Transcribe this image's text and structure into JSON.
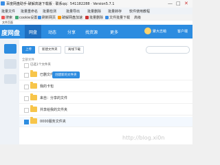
{
  "window": {
    "title": "百度网盘助手-破解高速下载版 · 联系qq：541182288 · Version5.7.1",
    "minimize": "—",
    "maximize": "□",
    "close": "✕"
  },
  "menu": {
    "items": [
      "批量文件",
      "批量重命名",
      "批量检测",
      "批量导出",
      "批量删除",
      "批量转存",
      "软件使用教程"
    ]
  },
  "toolbar": {
    "items": [
      "搜索",
      "cookie设置",
      "刷新网页",
      "破解网盘加速",
      "批量删除",
      "文件批量下载",
      "高级"
    ]
  },
  "address": {
    "text": "文件页面"
  },
  "nav": {
    "logo": "度网盘",
    "tabs": [
      "网盘",
      "动态",
      "分享",
      "找资源",
      "更多"
    ],
    "active_tab": 0,
    "user": "聚大志萌",
    "client": "客户端"
  },
  "actions": {
    "upload": "上传",
    "new_folder": "新建文件夹",
    "offline": "离线下载"
  },
  "breadcrumb": "全部文件",
  "select_all_label": "已选1个文件夹",
  "files": [
    {
      "name": "已删文件夹",
      "checked": false
    },
    {
      "name": "我的卡包",
      "checked": false
    },
    {
      "name": "来自：分享的文件",
      "checked": false
    },
    {
      "name": "共享给我的文件夹",
      "checked": false
    },
    {
      "name": "0000服务文件夹",
      "checked": true
    }
  ],
  "tooltip": "创建新的文件夹",
  "watermark": "http://blog.xi0n",
  "colors": {
    "brand": "#2c8ce0",
    "folder": "#f7c54a"
  }
}
